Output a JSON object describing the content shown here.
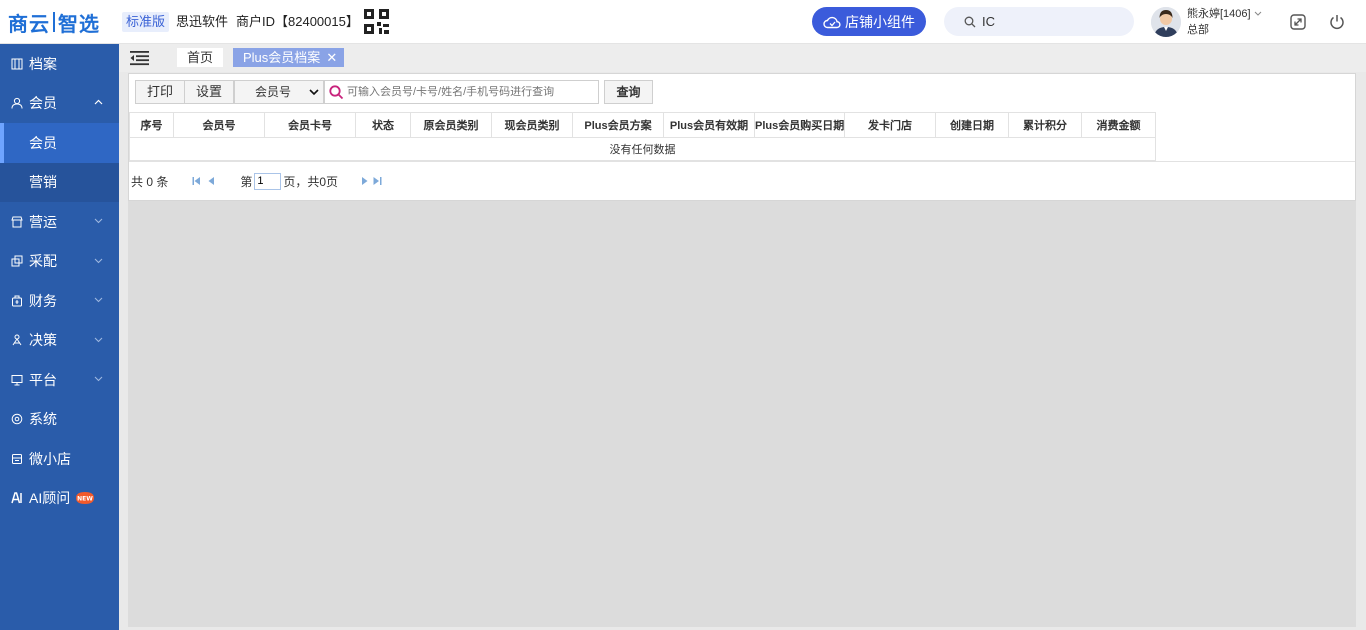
{
  "header": {
    "logo_left": "商云",
    "logo_right": "智选",
    "edition": "标准版",
    "company": "思迅软件",
    "merchant": "商户ID【82400015】",
    "widget_button": "店铺小组件",
    "search_value": "IC",
    "user_name": "熊永婷[1406]",
    "user_dept": "总部"
  },
  "sidebar": {
    "items": [
      {
        "label": "档案",
        "icon": "archive-icon"
      },
      {
        "label": "会员",
        "icon": "user-icon",
        "expanded": true
      },
      {
        "label": "会员",
        "sub": true,
        "active": true
      },
      {
        "label": "营销",
        "sub": true
      },
      {
        "label": "营运",
        "icon": "store-icon"
      },
      {
        "label": "采配",
        "icon": "purchase-icon"
      },
      {
        "label": "财务",
        "icon": "finance-icon"
      },
      {
        "label": "决策",
        "icon": "decision-icon"
      },
      {
        "label": "平台",
        "icon": "monitor-icon"
      },
      {
        "label": "系统",
        "icon": "settings-icon"
      },
      {
        "label": "微小店",
        "icon": "shop-icon"
      },
      {
        "label": "AI顾问",
        "icon": "ai-icon",
        "badge": "NEW"
      }
    ]
  },
  "tabs": {
    "home": "首页",
    "active": "Plus会员档案",
    "close": "✕"
  },
  "toolbar": {
    "print": "打印",
    "settings": "设置",
    "field_select": "会员号",
    "search_placeholder": "可输入会员号/卡号/姓名/手机号码进行查询",
    "query": "查询"
  },
  "table": {
    "columns": [
      "序号",
      "会员号",
      "会员卡号",
      "状态",
      "原会员类别",
      "现会员类别",
      "Plus会员方案",
      "Plus会员有效期",
      "Plus会员购买日期",
      "发卡门店",
      "创建日期",
      "累计积分",
      "消费金额"
    ],
    "empty_text": "没有任何数据"
  },
  "pager": {
    "total": "共 0 条",
    "page_prefix": "第",
    "page_value": "1",
    "page_suffix": "页，共0页"
  },
  "colors": {
    "sidebar_bg": "#2a5caa",
    "accent": "#3b5bdb",
    "active_tab": "#8aa3e6"
  }
}
